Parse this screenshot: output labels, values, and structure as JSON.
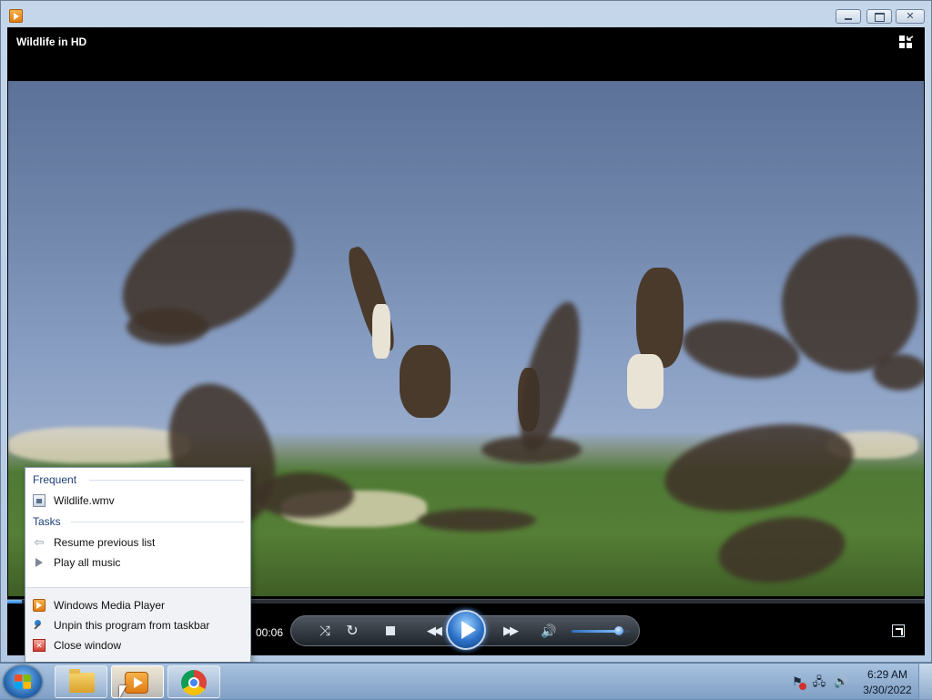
{
  "window": {
    "title": "Wildlife in HD"
  },
  "player": {
    "elapsed": "00:06",
    "progress_fraction": 0.016,
    "volume_fraction": 0.82
  },
  "jump_list": {
    "frequent_header": "Frequent",
    "frequent_items": [
      "Wildlife.wmv"
    ],
    "tasks_header": "Tasks",
    "tasks": [
      "Resume previous list",
      "Play all music"
    ],
    "program": "Windows Media Player",
    "unpin": "Unpin this program from taskbar",
    "close": "Close window"
  },
  "taskbar": {
    "items": [
      {
        "name": "Windows Explorer",
        "icon": "folder-icon"
      },
      {
        "name": "Windows Media Player",
        "icon": "wmp-icon",
        "active": true
      },
      {
        "name": "Google Chrome",
        "icon": "chrome-icon"
      }
    ],
    "clock": {
      "time": "6:29 AM",
      "date": "3/30/2022"
    }
  }
}
